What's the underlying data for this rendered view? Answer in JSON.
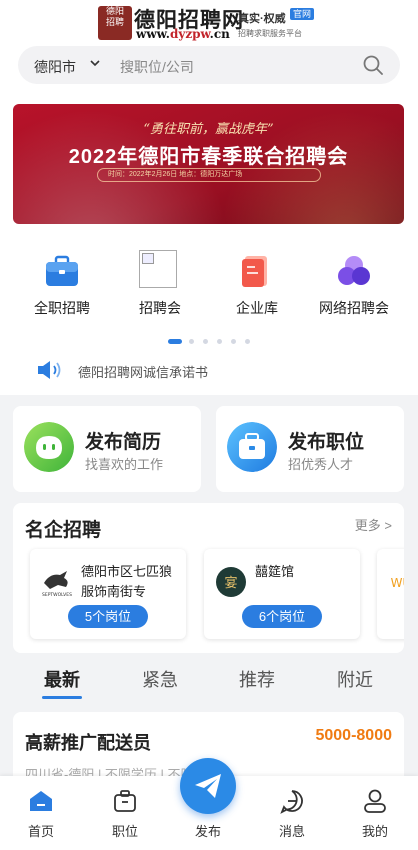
{
  "header": {
    "logo_seal": "德阳招聘网",
    "logo_name": "德阳招聘网",
    "logo_url_prefix": "www.",
    "logo_url_accent": "dyzpw",
    "logo_url_suffix": ".cn",
    "logo_tag": "真实·权威",
    "logo_badge": "官网",
    "logo_sub": "招聘求职服务平台"
  },
  "search": {
    "city": "德阳市",
    "placeholder": "搜职位/公司"
  },
  "banner": {
    "slogan": "“勇往职前，赢战虎年”",
    "title": "2022年德阳市春季联合招聘会",
    "info": "时间：2022年2月26日    地点：德阳万达广场"
  },
  "categories": [
    {
      "label": "全职招聘",
      "icon": "briefcase-icon"
    },
    {
      "label": "招聘会",
      "icon": "broken-image-icon"
    },
    {
      "label": "企业库",
      "icon": "company-icon"
    },
    {
      "label": "网络招聘会",
      "icon": "network-icon"
    }
  ],
  "pager": {
    "count": 6,
    "active": 0
  },
  "notice": "德阳招聘网诚信承诺书",
  "quick_actions": [
    {
      "title": "发布简历",
      "subtitle": "找喜欢的工作"
    },
    {
      "title": "发布职位",
      "subtitle": "招优秀人才"
    }
  ],
  "famous": {
    "title": "名企招聘",
    "more": "更多 >",
    "companies": [
      {
        "name": "德阳市区七匹狼服饰南街专",
        "jobs": "5个岗位",
        "logo_text": "SEPTWOLVES"
      },
      {
        "name": "囍筵馆",
        "jobs": "6个岗位",
        "logo_text": "宴"
      },
      {
        "name": "",
        "jobs": "",
        "logo_text": "WU"
      }
    ]
  },
  "tabs": [
    "最新",
    "紧急",
    "推荐",
    "附近"
  ],
  "job": {
    "title": "高薪推广配送员",
    "salary": "5000-8000",
    "meta": "四川省-德阳  |  不限学历  |  不限经验"
  },
  "tabbar": {
    "home": "首页",
    "jobs": "职位",
    "publish": "发布",
    "messages": "消息",
    "mine": "我的"
  },
  "colors": {
    "primary": "#2b7de0",
    "salary": "#f07b12",
    "banner": "#b8132a"
  }
}
